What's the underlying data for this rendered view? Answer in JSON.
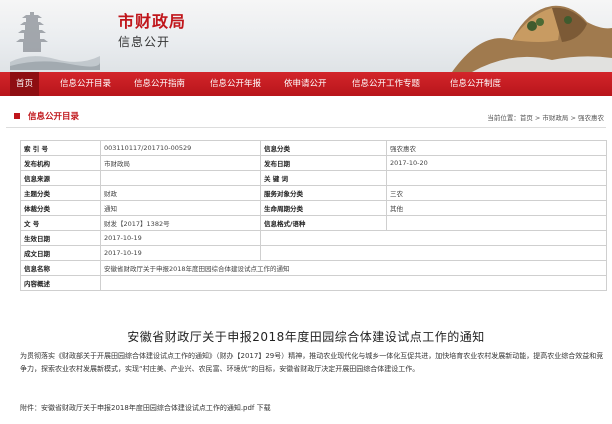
{
  "header": {
    "site_title": "市财政局",
    "site_subtitle": "信息公开"
  },
  "nav": {
    "items": [
      {
        "label": "首页",
        "active": true
      },
      {
        "label": "信息公开目录"
      },
      {
        "label": "信息公开指南"
      },
      {
        "label": "信息公开年报"
      },
      {
        "label": "依申请公开"
      },
      {
        "label": "信息公开工作专题"
      },
      {
        "label": "信息公开制度"
      }
    ]
  },
  "location": {
    "section_label": "信息公开目录",
    "breadcrumb": "当前位置：首页 > 市财政局 > 强农惠农"
  },
  "info_table": {
    "index_no_label": "索 引 号",
    "index_no": "003110117/201710-00529",
    "category_label": "信息分类",
    "category": "强农惠农",
    "publisher_label": "发布机构",
    "publisher": "市财政局",
    "pub_date_label": "发布日期",
    "pub_date": "2017-10-20",
    "source_label": "信息来源",
    "source": "",
    "keywords_label": "关 键 词",
    "keywords": "",
    "topic_label": "主题分类",
    "topic": "财政",
    "service_label": "服务对象分类",
    "service": "三农",
    "genre_label": "体裁分类",
    "genre": "通知",
    "lifecycle_label": "生命周期分类",
    "lifecycle": "其他",
    "doc_no_label": "文 号",
    "doc_no": "财发【2017】1382号",
    "format_label": "信息格式/语种",
    "format": "",
    "effective_label": "生效日期",
    "effective": "2017-10-19",
    "written_label": "成文日期",
    "written": "2017-10-19",
    "name_label": "信息名称",
    "name": "安徽省财政厅关于申报2018年度田园综合体建设试点工作的通知",
    "summary_label": "内容概述",
    "summary": ""
  },
  "article": {
    "title": "安徽省财政厅关于申报2018年度田园综合体建设试点工作的通知",
    "body": "为贯彻落实《财政部关于开展田园综合体建设试点工作的通知》（财办【2017】29号）精神，推动农业现代化与城乡一体化互促共进，加快培育农业农村发展新动能，提高农业综合效益和竞争力，探索农业农村发展新模式，实现“村庄美、产业兴、农民富、环境优”的目标，安徽省财政厅决定开展田园综合体建设工作。",
    "attachment_prefix": "附件：",
    "attachment_name": "安徽省财政厅关于申报2018年度田园综合体建设试点工作的通知.pdf",
    "download_label": "下载"
  }
}
